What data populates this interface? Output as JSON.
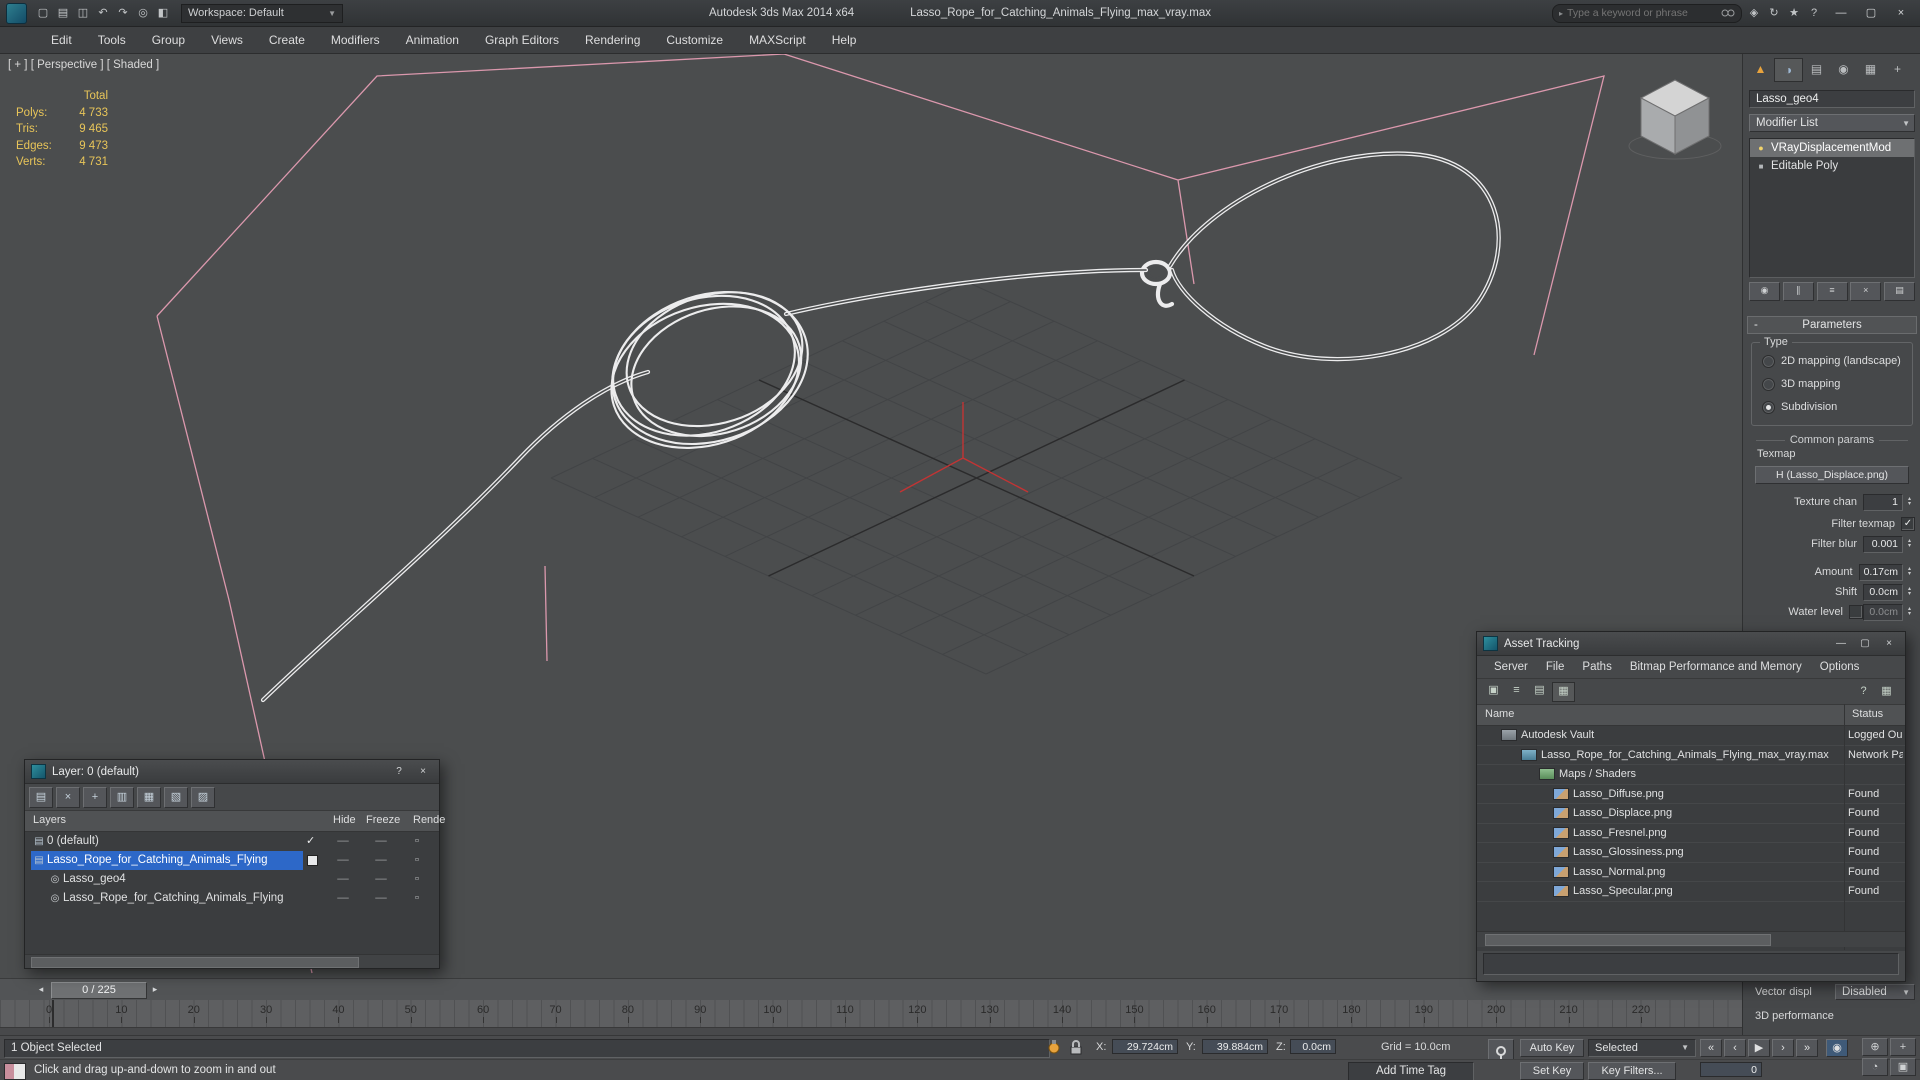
{
  "ui": {
    "combo_arrow": "▼",
    "spin_up": "▴",
    "spin_down": "▾",
    "search_arrow": "▸",
    "check_glyph": "✓",
    "minus_glyph": "-"
  },
  "titlebar": {
    "app_title": "Autodesk 3ds Max 2014 x64",
    "document_title": "Lasso_Rope_for_Catching_Animals_Flying_max_vray.max",
    "workspace_label": "Workspace: Default",
    "search_placeholder": "Type a keyword or phrase",
    "quick_icons": [
      {
        "id": "new-scene-icon",
        "glyph": "▢"
      },
      {
        "id": "open-file-icon",
        "glyph": "▤"
      },
      {
        "id": "save-file-icon",
        "glyph": "◫"
      },
      {
        "id": "undo-icon",
        "glyph": "↶"
      },
      {
        "id": "redo-icon",
        "glyph": "↷"
      },
      {
        "id": "fetch-icon",
        "glyph": "◎"
      },
      {
        "id": "project-folder-icon",
        "glyph": "◧"
      }
    ],
    "right_icons": [
      {
        "id": "communication-center-icon",
        "glyph": "◈"
      },
      {
        "id": "sync-icon",
        "glyph": "↻"
      },
      {
        "id": "favorites-icon",
        "glyph": "★"
      },
      {
        "id": "infocenter-help-icon",
        "glyph": "?"
      }
    ],
    "window_buttons": [
      {
        "id": "minimize-button",
        "glyph": "—"
      },
      {
        "id": "maximize-button",
        "glyph": "▢"
      },
      {
        "id": "close-button",
        "glyph": "×"
      }
    ]
  },
  "menubar": {
    "items": [
      "Edit",
      "Tools",
      "Group",
      "Views",
      "Create",
      "Modifiers",
      "Animation",
      "Graph Editors",
      "Rendering",
      "Customize",
      "MAXScript",
      "Help"
    ]
  },
  "viewport": {
    "label": "[ + ] [ Perspective ] [ Shaded ]",
    "stats": {
      "header": "Total",
      "rows": [
        {
          "label": "Polys:",
          "value": "4 733"
        },
        {
          "label": "Tris:",
          "value": "9 465"
        },
        {
          "label": "Edges:",
          "value": "9 473"
        },
        {
          "label": "Verts:",
          "value": "4 731"
        }
      ]
    }
  },
  "command_panel": {
    "tabs": [
      {
        "id": "tab-create",
        "glyph": "▲",
        "cls": "create"
      },
      {
        "id": "tab-modify",
        "glyph": "◑",
        "cls": "modify active"
      },
      {
        "id": "tab-hierarchy",
        "glyph": "▤",
        "cls": ""
      },
      {
        "id": "tab-motion",
        "glyph": "◉",
        "cls": ""
      },
      {
        "id": "tab-display",
        "glyph": "▦",
        "cls": ""
      },
      {
        "id": "tab-utilities",
        "glyph": "+",
        "cls": ""
      }
    ],
    "object_name": "Lasso_geo4",
    "modifier_list_label": "Modifier List",
    "stack": [
      {
        "label": "VRayDisplacementMod",
        "icon": "bulb",
        "cls": "selected"
      },
      {
        "label": "Editable Poly",
        "icon": "poly",
        "cls": ""
      }
    ],
    "stack_buttons": [
      {
        "id": "pin-stack-button",
        "glyph": "◉"
      },
      {
        "id": "show-end-result-button",
        "glyph": "∥"
      },
      {
        "id": "make-unique-button",
        "glyph": "≡"
      },
      {
        "id": "remove-modifier-button",
        "glyph": "×"
      },
      {
        "id": "configure-modifier-sets-button",
        "glyph": "▤"
      }
    ],
    "rollout_title": "Parameters",
    "type_group": {
      "title": "Type",
      "options": [
        {
          "label": "2D mapping (landscape)",
          "cls": ""
        },
        {
          "label": "3D mapping",
          "cls": ""
        },
        {
          "label": "Subdivision",
          "cls": "on"
        }
      ]
    },
    "common_params_label": "Common params",
    "texmap_label": "Texmap",
    "texmap_button_label": "H (Lasso_Displace.png)",
    "rows": {
      "texture_chan": {
        "label": "Texture chan",
        "value": "1"
      },
      "filter_texmap": {
        "label": "Filter texmap"
      },
      "filter_blur": {
        "label": "Filter blur",
        "value": "0.001"
      },
      "amount": {
        "label": "Amount",
        "value": "0.17cm"
      },
      "shift": {
        "label": "Shift",
        "value": "0.0cm"
      },
      "water_level": {
        "label": "Water level",
        "value": "0.0cm"
      }
    },
    "vector_displ": {
      "label": "Vector displ",
      "value": "Disabled"
    },
    "performance_label": "3D performance"
  },
  "layer_window": {
    "title": "Layer: 0 (default)",
    "help_glyph": "?",
    "close_glyph": "×",
    "dash_glyph": "—",
    "render_glyph": "▫",
    "toolbar": [
      {
        "id": "new-layer-button",
        "glyph": "▤"
      },
      {
        "id": "delete-layer-button",
        "glyph": "×"
      },
      {
        "id": "add-to-layer-button",
        "glyph": "+"
      },
      {
        "id": "select-layer-objects-button",
        "glyph": "▥"
      },
      {
        "id": "set-current-layer-button",
        "glyph": "▦"
      },
      {
        "id": "highlight-layer-button",
        "glyph": "▧"
      },
      {
        "id": "hide-layer-button",
        "glyph": "▨"
      }
    ],
    "columns": {
      "layers": "Layers",
      "hide": "Hide",
      "freeze": "Freeze",
      "render": "Rende"
    },
    "rows": [
      {
        "name": "0 (default)",
        "icon": "layer",
        "pad": 6,
        "current": true,
        "cls": ""
      },
      {
        "name": "Lasso_Rope_for_Catching_Animals_Flying",
        "icon": "layer",
        "pad": 6,
        "box": true,
        "cls": "selected"
      },
      {
        "name": "Lasso_geo4",
        "icon": "object",
        "pad": 22,
        "cls": ""
      },
      {
        "name": "Lasso_Rope_for_Catching_Animals_Flying",
        "icon": "object",
        "pad": 22,
        "cls": ""
      }
    ]
  },
  "asset_window": {
    "title": "Asset Tracking",
    "min_glyph": "—",
    "max_glyph": "▢",
    "close_glyph": "×",
    "menu": [
      "Server",
      "File",
      "Paths",
      "Bitmap Performance and Memory",
      "Options"
    ],
    "toolbar_left": [
      {
        "id": "refresh-button",
        "glyph": "▣"
      },
      {
        "id": "list-view-button",
        "glyph": "≡"
      },
      {
        "id": "detail-view-button",
        "glyph": "▤"
      },
      {
        "id": "table-view-button",
        "glyph": "▦",
        "cls": "pressed"
      }
    ],
    "toolbar_right": [
      {
        "id": "help-button",
        "glyph": "?"
      },
      {
        "id": "grid-button",
        "glyph": "▦"
      }
    ],
    "columns": {
      "name": "Name",
      "status": "Status"
    },
    "rows": [
      {
        "name": "Autodesk Vault",
        "status": "Logged Ou",
        "pad": 24,
        "icon": "vault"
      },
      {
        "name": "Lasso_Rope_for_Catching_Animals_Flying_max_vray.max",
        "status": "Network Pa",
        "pad": 44,
        "icon": "maxfile"
      },
      {
        "name": "Maps / Shaders",
        "status": "",
        "pad": 62,
        "icon": "maps"
      },
      {
        "name": "Lasso_Diffuse.png",
        "status": "Found",
        "pad": 76,
        "icon": "image"
      },
      {
        "name": "Lasso_Displace.png",
        "status": "Found",
        "pad": 76,
        "icon": "image"
      },
      {
        "name": "Lasso_Fresnel.png",
        "status": "Found",
        "pad": 76,
        "icon": "image"
      },
      {
        "name": "Lasso_Glossiness.png",
        "status": "Found",
        "pad": 76,
        "icon": "image"
      },
      {
        "name": "Lasso_Normal.png",
        "status": "Found",
        "pad": 76,
        "icon": "image"
      },
      {
        "name": "Lasso_Specular.png",
        "status": "Found",
        "pad": 76,
        "icon": "image"
      }
    ]
  },
  "timeline": {
    "slider_label": "0 / 225",
    "left_arrow": "◂",
    "right_arrow": "▸",
    "tick_labels": [
      "0",
      "10",
      "20",
      "30",
      "40",
      "50",
      "60",
      "70",
      "80",
      "90",
      "100",
      "110",
      "120",
      "130",
      "140",
      "150",
      "160",
      "170",
      "180",
      "190",
      "200",
      "210",
      "220"
    ]
  },
  "statusbar": {
    "selection_text": "1 Object Selected",
    "coords": {
      "x_label": "X:",
      "x_value": "29.724cm",
      "y_label": "Y:",
      "y_value": "39.884cm",
      "z_label": "Z:",
      "z_value": "0.0cm"
    },
    "grid_text": "Grid = 10.0cm",
    "auto_key_label": "Auto Key",
    "set_key_label": "Set Key",
    "selected_mode_value": "Selected",
    "key_filters_label": "Key Filters...",
    "frame_value": "0",
    "playback": [
      {
        "id": "go-to-start-button",
        "glyph": "«"
      },
      {
        "id": "previous-frame-button",
        "glyph": "‹"
      },
      {
        "id": "play-button",
        "glyph": "▶"
      },
      {
        "id": "next-frame-button",
        "glyph": "›"
      },
      {
        "id": "go-to-end-button",
        "glyph": "»"
      }
    ],
    "key_mode_glyph": "◉",
    "nav_buttons": [
      {
        "id": "zoom-button",
        "glyph": "⊕"
      },
      {
        "id": "pan-button",
        "glyph": "+"
      },
      {
        "id": "orbit-button",
        "glyph": "◔"
      },
      {
        "id": "maximize-viewport-button",
        "glyph": "▣"
      }
    ]
  },
  "promptbar": {
    "prompt_text": "Click and drag up-and-down to zoom in and out",
    "add_time_tag": "Add Time Tag"
  }
}
